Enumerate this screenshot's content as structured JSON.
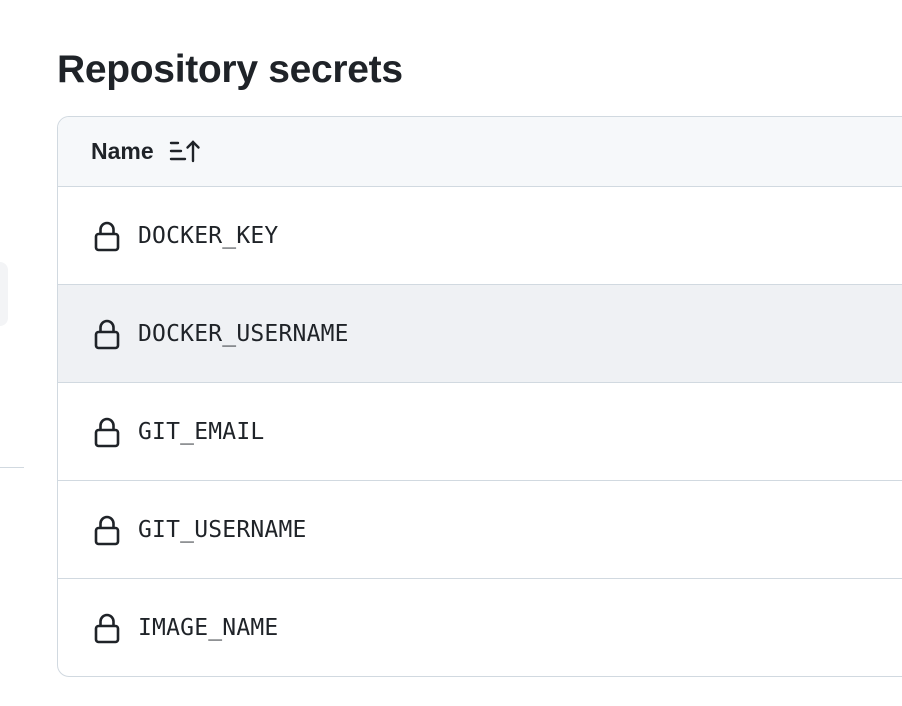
{
  "page": {
    "title": "Repository secrets"
  },
  "table": {
    "header": {
      "name_label": "Name",
      "sort_icon": "sort-ascending-icon"
    },
    "rows": [
      {
        "name": "DOCKER_KEY",
        "icon": "lock-icon"
      },
      {
        "name": "DOCKER_USERNAME",
        "icon": "lock-icon"
      },
      {
        "name": "GIT_EMAIL",
        "icon": "lock-icon"
      },
      {
        "name": "GIT_USERNAME",
        "icon": "lock-icon"
      },
      {
        "name": "IMAGE_NAME",
        "icon": "lock-icon"
      }
    ]
  },
  "colors": {
    "text": "#1f2328",
    "border": "#d1d9e0",
    "header_bg": "#f6f8fa",
    "hover_row_bg": "#eff1f4"
  }
}
